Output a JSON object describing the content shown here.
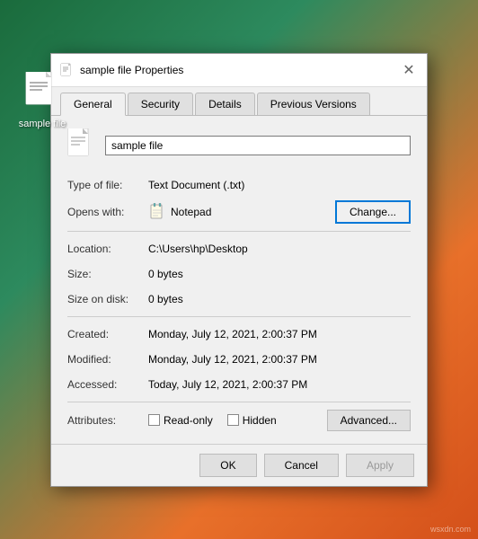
{
  "desktop": {
    "icon_label": "sample file"
  },
  "dialog": {
    "title": "sample file Properties",
    "close_label": "✕",
    "tabs": [
      {
        "label": "General",
        "active": true
      },
      {
        "label": "Security",
        "active": false
      },
      {
        "label": "Details",
        "active": false
      },
      {
        "label": "Previous Versions",
        "active": false
      }
    ],
    "filename_value": "sample file",
    "rows": [
      {
        "label": "Type of file:",
        "value": "Text Document (.txt)"
      },
      {
        "label": "Location:",
        "value": "C:\\Users\\hp\\Desktop"
      },
      {
        "label": "Size:",
        "value": "0 bytes"
      },
      {
        "label": "Size on disk:",
        "value": "0 bytes"
      },
      {
        "label": "Created:",
        "value": "Monday, July 12, 2021, 2:00:37 PM"
      },
      {
        "label": "Modified:",
        "value": "Monday, July 12, 2021, 2:00:37 PM"
      },
      {
        "label": "Accessed:",
        "value": "Today, July 12, 2021, 2:00:37 PM"
      }
    ],
    "opens_with_label": "Opens with:",
    "opens_with_app": "Notepad",
    "change_btn_label": "Change...",
    "attributes_label": "Attributes:",
    "readonly_label": "Read-only",
    "hidden_label": "Hidden",
    "advanced_btn_label": "Advanced...",
    "ok_label": "OK",
    "cancel_label": "Cancel",
    "apply_label": "Apply"
  },
  "watermark": "wsxdn.com"
}
